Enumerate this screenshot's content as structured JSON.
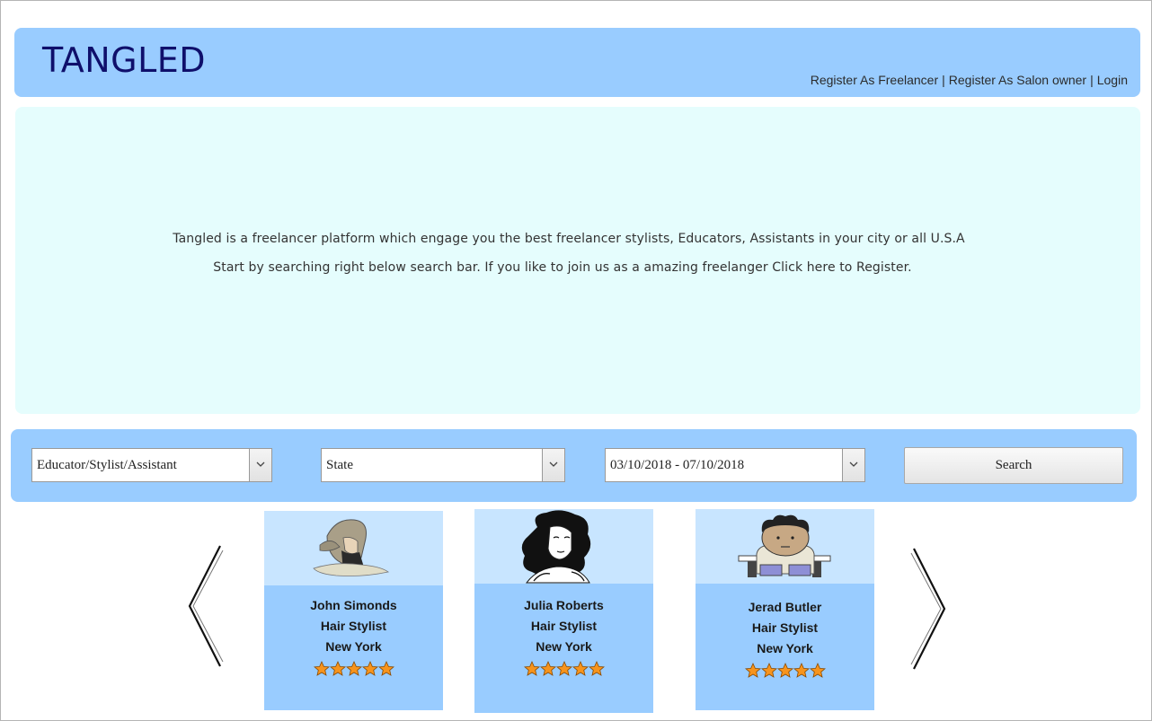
{
  "brand": {
    "logo": "TANGLED"
  },
  "topnav": {
    "register_freelancer": "Register As Freelancer",
    "register_salon": "Register As Salon owner",
    "login": "Login",
    "separator": "|"
  },
  "hero": {
    "line1": "Tangled is a freelancer platform which engage you the best freelancer stylists, Educators, Assistants in  your city or all U.S.A",
    "line2": "Start by searching right below search bar. If you like to join us as a amazing freelanger Click here to Register."
  },
  "search": {
    "role_value": "Educator/Stylist/Assistant",
    "state_value": "State",
    "date_value": "03/10/2018 - 07/10/2018",
    "button": "Search"
  },
  "cards": [
    {
      "name": "John Simonds",
      "role": "Hair Stylist",
      "city": "New York",
      "rating": 5
    },
    {
      "name": "Julia Roberts",
      "role": "Hair Stylist",
      "city": "New York",
      "rating": 5
    },
    {
      "name": "Jerad Butler",
      "role": "Hair Stylist",
      "city": "New York",
      "rating": 5
    }
  ],
  "colors": {
    "header_bg": "#99ccff",
    "hero_bg": "#e5fdfd",
    "logo": "#0f0f6b",
    "card_photo_bg": "#c8e5ff",
    "star": "#f7941d"
  },
  "icons": {
    "prev": "chevron-left-icon",
    "next": "chevron-right-icon",
    "dropdown": "chevron-down-icon",
    "rating": "star-icon"
  }
}
